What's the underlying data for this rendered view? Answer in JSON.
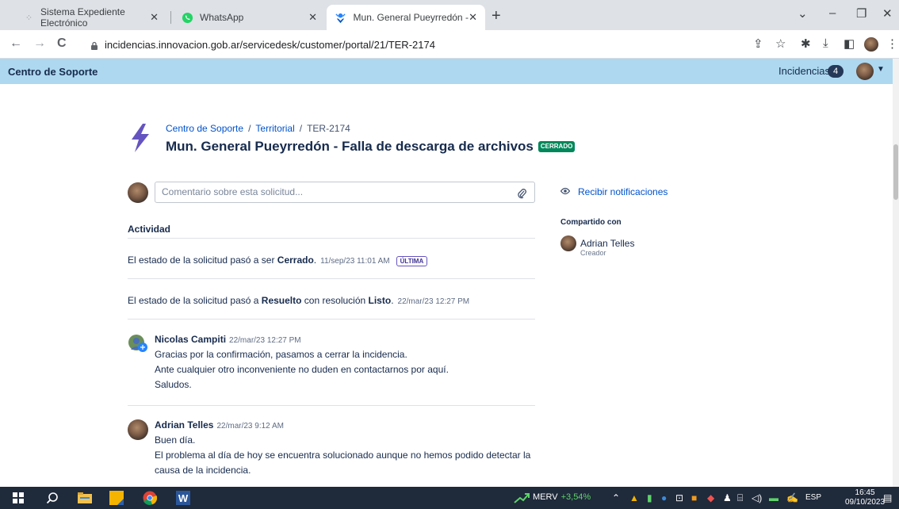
{
  "browser": {
    "tabs": [
      {
        "title": "Sistema Expediente Electrónico",
        "icon": "expediente-icon"
      },
      {
        "title": "WhatsApp",
        "icon": "whatsapp-icon"
      },
      {
        "title": "Mun. General Pueyrredón - Falla",
        "icon": "jira-sd-icon"
      }
    ],
    "url": "incidencias.innovacion.gob.ar/servicedesk/customer/portal/21/TER-2174"
  },
  "header": {
    "brand": "Centro de Soporte",
    "incidencias_label": "Incidencias",
    "incidencias_count": "4"
  },
  "request": {
    "breadcrumbs": [
      "Centro de Soporte",
      "Territorial",
      "TER-2174"
    ],
    "title": "Mun. General Pueyrredón - Falla de descarga de archivos",
    "status": "CERRADO",
    "comment_placeholder": "Comentario sobre esta solicitud..."
  },
  "activity": {
    "label": "Actividad",
    "events": [
      {
        "prefix": "El estado de la solicitud pasó a ser ",
        "bold": "Cerrado",
        "suffix": ".",
        "time": "11/sep/23 11:01 AM",
        "tag": "ÚLTIMA"
      },
      {
        "prefix": "El estado de la solicitud pasó a ",
        "bold": "Resuelto",
        "mid": " con resolución ",
        "bold2": "Listo",
        "suffix": ".",
        "time": "22/mar/23 12:27 PM"
      }
    ],
    "comments": [
      {
        "author": "Nicolas Campiti",
        "time": "22/mar/23 12:27 PM",
        "lines": [
          "Gracias por la confirmación, pasamos a cerrar la incidencia.",
          "Ante cualquier otro inconveniente no duden en contactarnos por aquí.",
          "Saludos."
        ]
      },
      {
        "author": "Adrian Telles",
        "time": "22/mar/23 9:12 AM",
        "lines": [
          "Buen día.",
          "El problema al día de hoy se encuentra solucionado aunque no hemos podido detectar la",
          "causa de la incidencia."
        ]
      }
    ]
  },
  "sidebar": {
    "notify_label": "Recibir notificaciones",
    "shared_label": "Compartido con",
    "shared_name": "Adrian Telles",
    "shared_role": "Creador"
  },
  "taskbar": {
    "ticker": "MERV",
    "ticker_change": "+3,54%",
    "lang": "ESP",
    "time": "16:45",
    "date": "09/10/2023"
  },
  "colors": {
    "header_bg": "#add8f0",
    "status_green": "#00875a",
    "link": "#0052cc",
    "ultima": "#6554c0"
  }
}
